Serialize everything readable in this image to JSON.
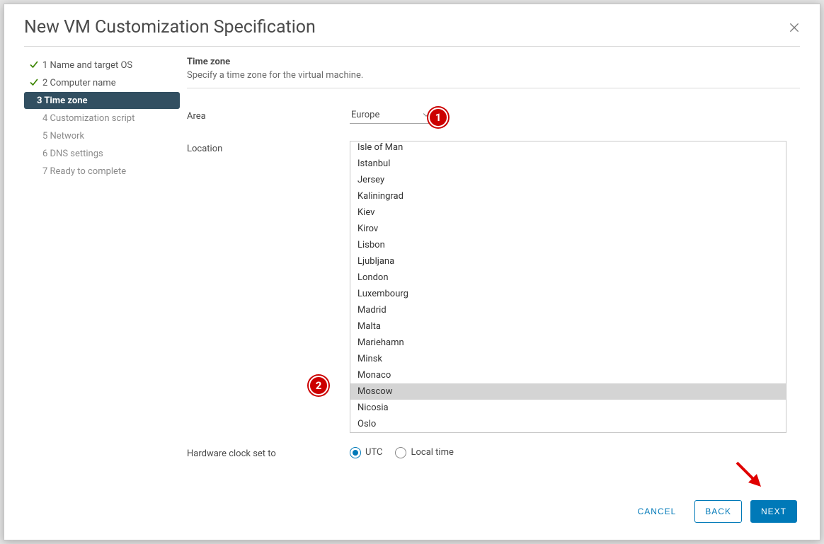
{
  "modal": {
    "title": "New VM Customization Specification"
  },
  "nav": {
    "steps": [
      {
        "label": "1 Name and target OS",
        "state": "completed"
      },
      {
        "label": "2 Computer name",
        "state": "completed"
      },
      {
        "label": "3 Time zone",
        "state": "active"
      },
      {
        "label": "4 Customization script",
        "state": "pending"
      },
      {
        "label": "5 Network",
        "state": "pending"
      },
      {
        "label": "6 DNS settings",
        "state": "pending"
      },
      {
        "label": "7 Ready to complete",
        "state": "pending"
      }
    ]
  },
  "content": {
    "title": "Time zone",
    "description": "Specify a time zone for the virtual machine.",
    "area_label": "Area",
    "area_value": "Europe",
    "location_label": "Location",
    "hwclock_label": "Hardware clock set to",
    "hwclock_options": {
      "utc": "UTC",
      "local": "Local time"
    },
    "hwclock_selected": "utc"
  },
  "locations": [
    "Isle of Man",
    "Istanbul",
    "Jersey",
    "Kaliningrad",
    "Kiev",
    "Kirov",
    "Lisbon",
    "Ljubljana",
    "London",
    "Luxembourg",
    "Madrid",
    "Malta",
    "Mariehamn",
    "Minsk",
    "Monaco",
    "Moscow",
    "Nicosia",
    "Oslo"
  ],
  "location_selected": "Moscow",
  "footer": {
    "cancel": "CANCEL",
    "back": "BACK",
    "next": "NEXT"
  },
  "callouts": {
    "c1": "1",
    "c2": "2"
  }
}
